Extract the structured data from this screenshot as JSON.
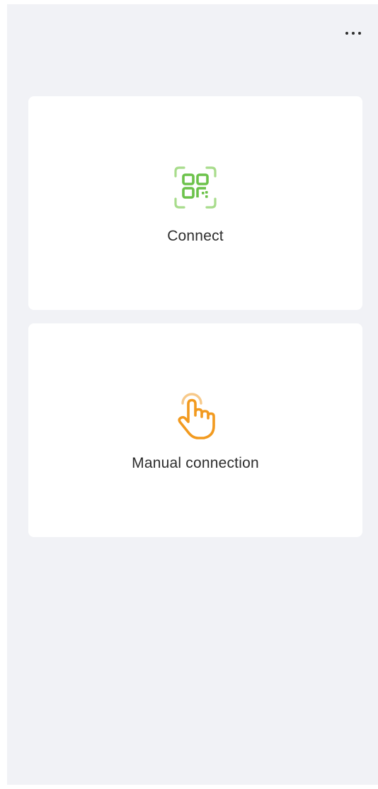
{
  "header": {
    "more_icon": "more-horizontal-icon"
  },
  "options": [
    {
      "label": "Connect",
      "icon": "qr-scan-icon",
      "icon_color": "#6cc24a",
      "icon_frame_color": "#a8dc8c"
    },
    {
      "label": "Manual connection",
      "icon": "hand-tap-icon",
      "icon_color": "#f29a1f",
      "icon_ring_color": "#f7c98a"
    }
  ],
  "colors": {
    "background": "#f1f2f6",
    "card": "#ffffff",
    "text": "#2d2d2d"
  }
}
